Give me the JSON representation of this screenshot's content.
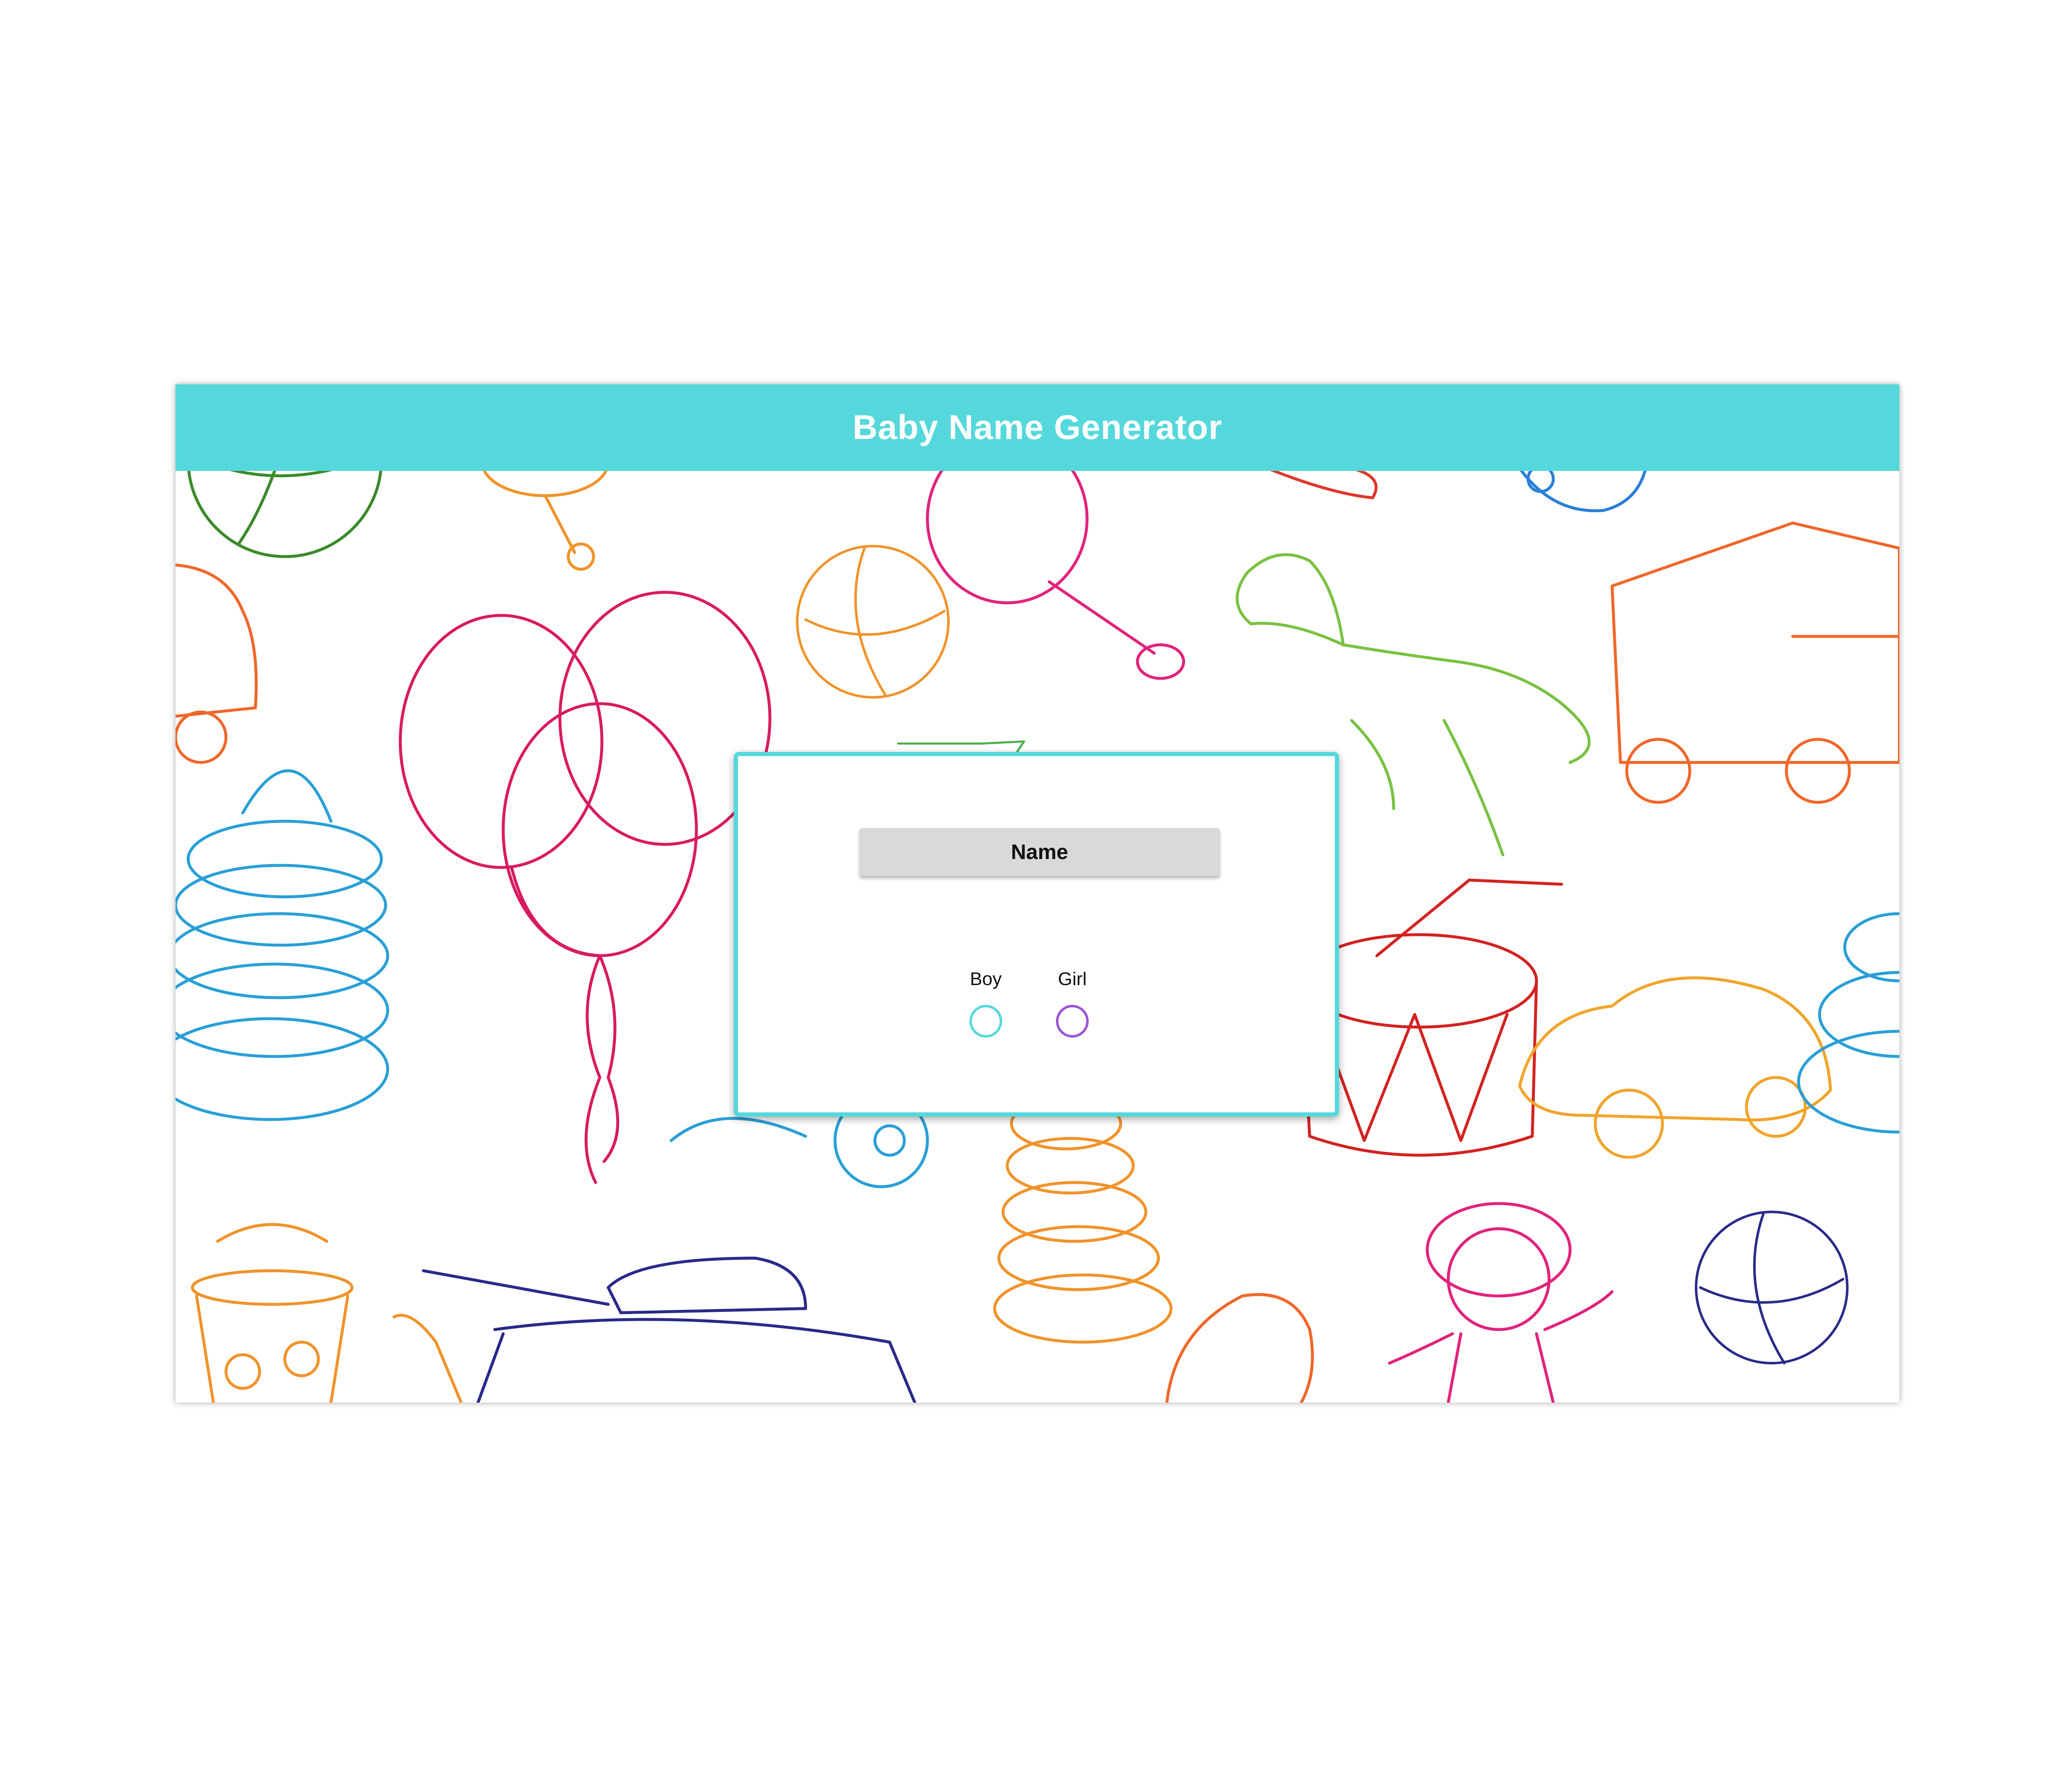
{
  "header": {
    "title": "Baby Name Generator",
    "background_color": "#55d8dc"
  },
  "card": {
    "border_color": "#55d8dc",
    "name_button_label": "Name",
    "options": [
      {
        "label": "Boy",
        "color": "#55d8dc"
      },
      {
        "label": "Girl",
        "color": "#9a55d6"
      }
    ]
  },
  "background": {
    "description_icons": [
      "ball-icon",
      "rattle-icon",
      "balloons-icon",
      "rocking-horse-icon",
      "truck-icon",
      "car-icon",
      "stacking-rings-icon",
      "drum-icon",
      "tank-icon",
      "doll-icon",
      "bucket-icon"
    ]
  }
}
